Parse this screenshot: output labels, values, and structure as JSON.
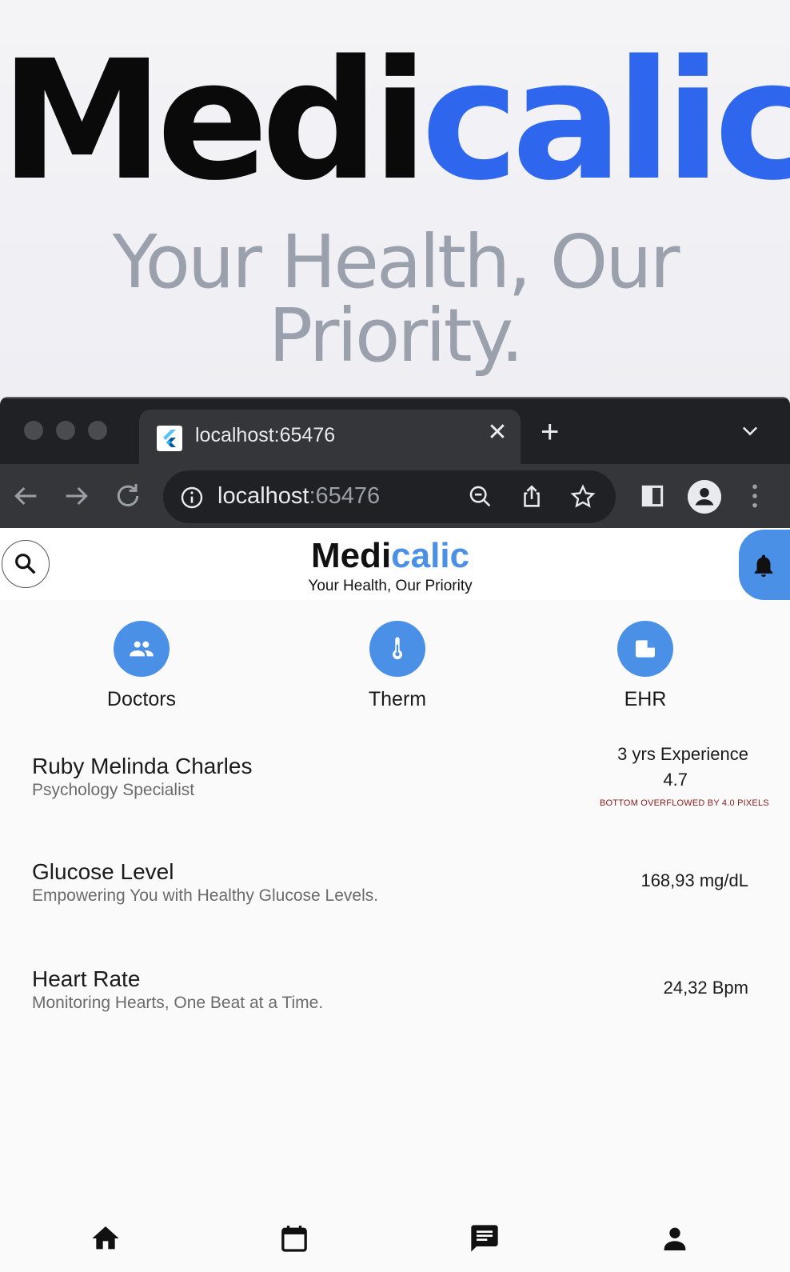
{
  "hero": {
    "logo_part1": "Medi",
    "logo_part2": "calic",
    "tagline": "Your Health, Our Priority."
  },
  "browser": {
    "tab": {
      "title": "localhost:65476",
      "favicon": "flutter-icon"
    },
    "address": {
      "host": "localhost",
      "port": ":65476"
    },
    "toolbar_icons": [
      "back-icon",
      "forward-icon",
      "reload-icon",
      "info-icon",
      "zoom-out-icon",
      "share-icon",
      "star-icon",
      "side-panel-icon",
      "profile-icon",
      "menu-icon"
    ]
  },
  "app": {
    "brand_part1": "Medi",
    "brand_part2": "calic",
    "tagline": "Your Health, Our Priority",
    "accent": "#4a90e6",
    "categories": [
      {
        "label": "Doctors",
        "icon": "people-icon"
      },
      {
        "label": "Therm",
        "icon": "thermometer-icon"
      },
      {
        "label": "EHR",
        "icon": "label-icon"
      }
    ],
    "doctor": {
      "name": "Ruby Melinda Charles",
      "specialty": "Psychology Specialist",
      "experience": "3 yrs Experience",
      "rating": "4.7",
      "overflow_notice": "BOTTOM OVERFLOWED BY 4.0 PIXELS"
    },
    "glucose": {
      "title": "Glucose Level",
      "subtitle": "Empowering You with Healthy Glucose Levels.",
      "value": "168,93 mg/dL"
    },
    "heart": {
      "title": "Heart Rate",
      "subtitle": "Monitoring Hearts, One Beat at a Time.",
      "value": "24,32 Bpm"
    },
    "nav_icons": [
      "home-icon",
      "calendar-icon",
      "chat-icon",
      "person-icon"
    ]
  }
}
